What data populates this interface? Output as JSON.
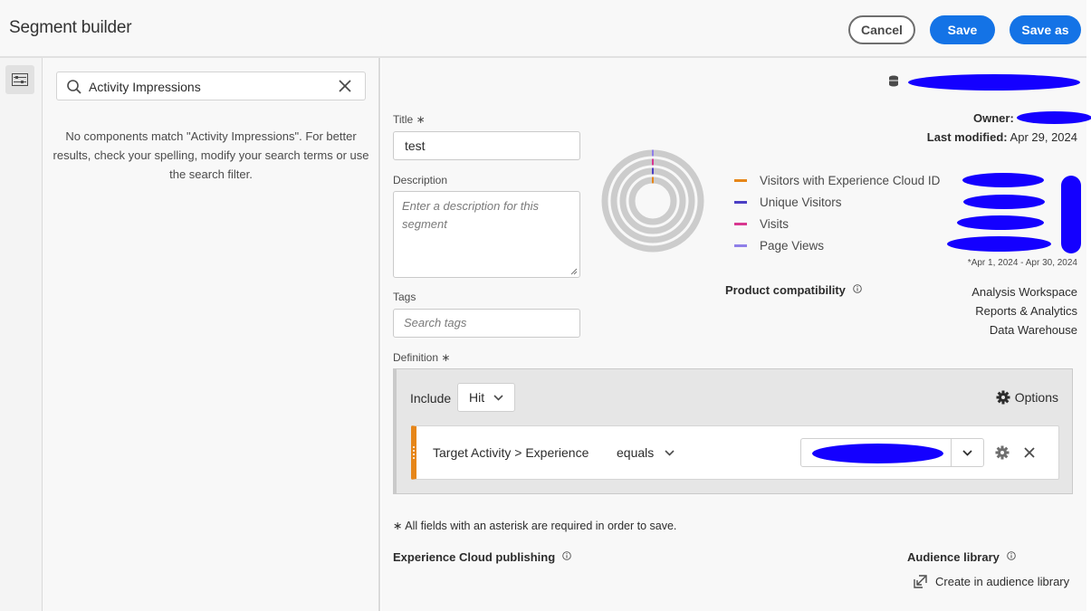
{
  "header": {
    "title": "Segment builder",
    "cancel_label": "Cancel",
    "save_label": "Save",
    "save_as_label": "Save as"
  },
  "left_panel": {
    "search_value": "Activity Impressions",
    "no_match_text": "No components match \"Activity Impressions\". For better results, check your spelling, modify your search terms or use the search filter."
  },
  "form": {
    "title_label": "Title",
    "title_value": "test",
    "description_label": "Description",
    "description_placeholder": "Enter a description for this segment",
    "tags_label": "Tags",
    "tags_placeholder": "Search tags",
    "definition_label": "Definition",
    "required_note": "All fields with an asterisk are required in order to save."
  },
  "meta": {
    "owner_label": "Owner:",
    "last_modified_label": "Last modified:",
    "last_modified_value": "Apr 29, 2024",
    "date_range_note": "*Apr 1, 2024 - Apr 30, 2024"
  },
  "summary": {
    "legend": [
      {
        "label": "Visitors with Experience Cloud ID",
        "color": "#e68619"
      },
      {
        "label": "Unique Visitors",
        "color": "#4b3fc4"
      },
      {
        "label": "Visits",
        "color": "#d83790"
      },
      {
        "label": "Page Views",
        "color": "#8f7fe8"
      }
    ],
    "ring_color": "#cccccc"
  },
  "compatibility": {
    "label": "Product compatibility",
    "products": [
      "Analysis Workspace",
      "Reports & Analytics",
      "Data Warehouse"
    ]
  },
  "definition": {
    "include_label": "Include",
    "scope_value": "Hit",
    "options_label": "Options",
    "rule_dimension": "Target Activity > Experience",
    "rule_operator": "equals"
  },
  "publishing": {
    "experience_cloud_label": "Experience Cloud publishing",
    "audience_library_label": "Audience library",
    "create_audience_label": "Create in audience library"
  },
  "colors": {
    "accent_blue": "#1473e6",
    "rule_accent": "#e68619",
    "redaction": "#1400ff"
  }
}
